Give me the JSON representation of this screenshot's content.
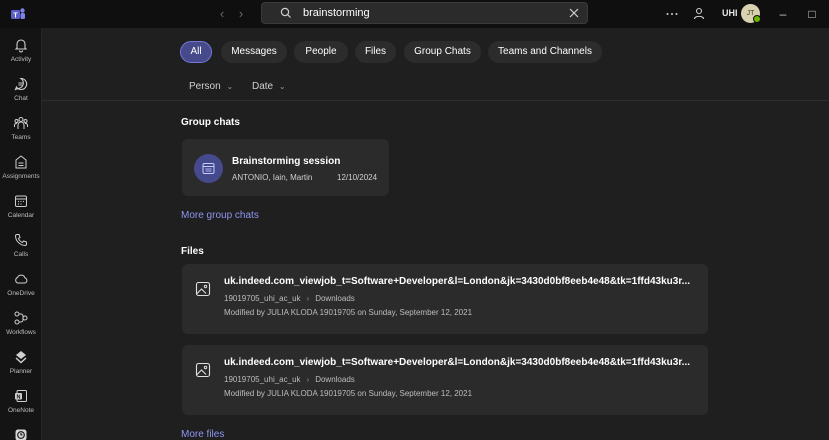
{
  "search": {
    "query": "brainstorming"
  },
  "titlebar": {
    "user_initials": "UHI",
    "avatar_initials": "JT"
  },
  "rail": {
    "items": [
      {
        "label": "Activity",
        "icon": "bell-icon"
      },
      {
        "label": "Chat",
        "icon": "chat-icon"
      },
      {
        "label": "Teams",
        "icon": "teams-icon"
      },
      {
        "label": "Assignments",
        "icon": "assignments-icon"
      },
      {
        "label": "Calendar",
        "icon": "calendar-icon"
      },
      {
        "label": "Calls",
        "icon": "phone-icon"
      },
      {
        "label": "OneDrive",
        "icon": "cloud-icon"
      },
      {
        "label": "Workflows",
        "icon": "workflows-icon"
      },
      {
        "label": "Planner",
        "icon": "planner-icon"
      },
      {
        "label": "OneNote",
        "icon": "onenote-icon"
      }
    ]
  },
  "filters": {
    "tabs": [
      "All",
      "Messages",
      "People",
      "Files",
      "Group Chats",
      "Teams and Channels"
    ],
    "active": "All",
    "person_label": "Person",
    "date_label": "Date"
  },
  "group_chats": {
    "title": "Group chats",
    "chat": {
      "name": "Brainstorming session",
      "members": "ANTONIO, Iain, Martin",
      "date": "12/10/2024"
    },
    "more_link": "More group chats"
  },
  "files": {
    "title": "Files",
    "items": [
      {
        "name": "uk.indeed.com_viewjob_t=Software+Developer&l=London&jk=3430d0bf8eeb4e48&tk=1ffd43ku3r...",
        "owner": "19019705_uhi_ac_uk",
        "folder": "Downloads",
        "modified": "Modified by JULIA KLODA 19019705 on Sunday, September 12, 2021"
      },
      {
        "name": "uk.indeed.com_viewjob_t=Software+Developer&l=London&jk=3430d0bf8eeb4e48&tk=1ffd43ku3r...",
        "owner": "19019705_uhi_ac_uk",
        "folder": "Downloads",
        "modified": "Modified by JULIA KLODA 19019705 on Sunday, September 12, 2021"
      }
    ],
    "more_link": "More files"
  },
  "colors": {
    "accent": "#7378d8",
    "link": "#8e95f0",
    "presence": "#6bb700"
  }
}
